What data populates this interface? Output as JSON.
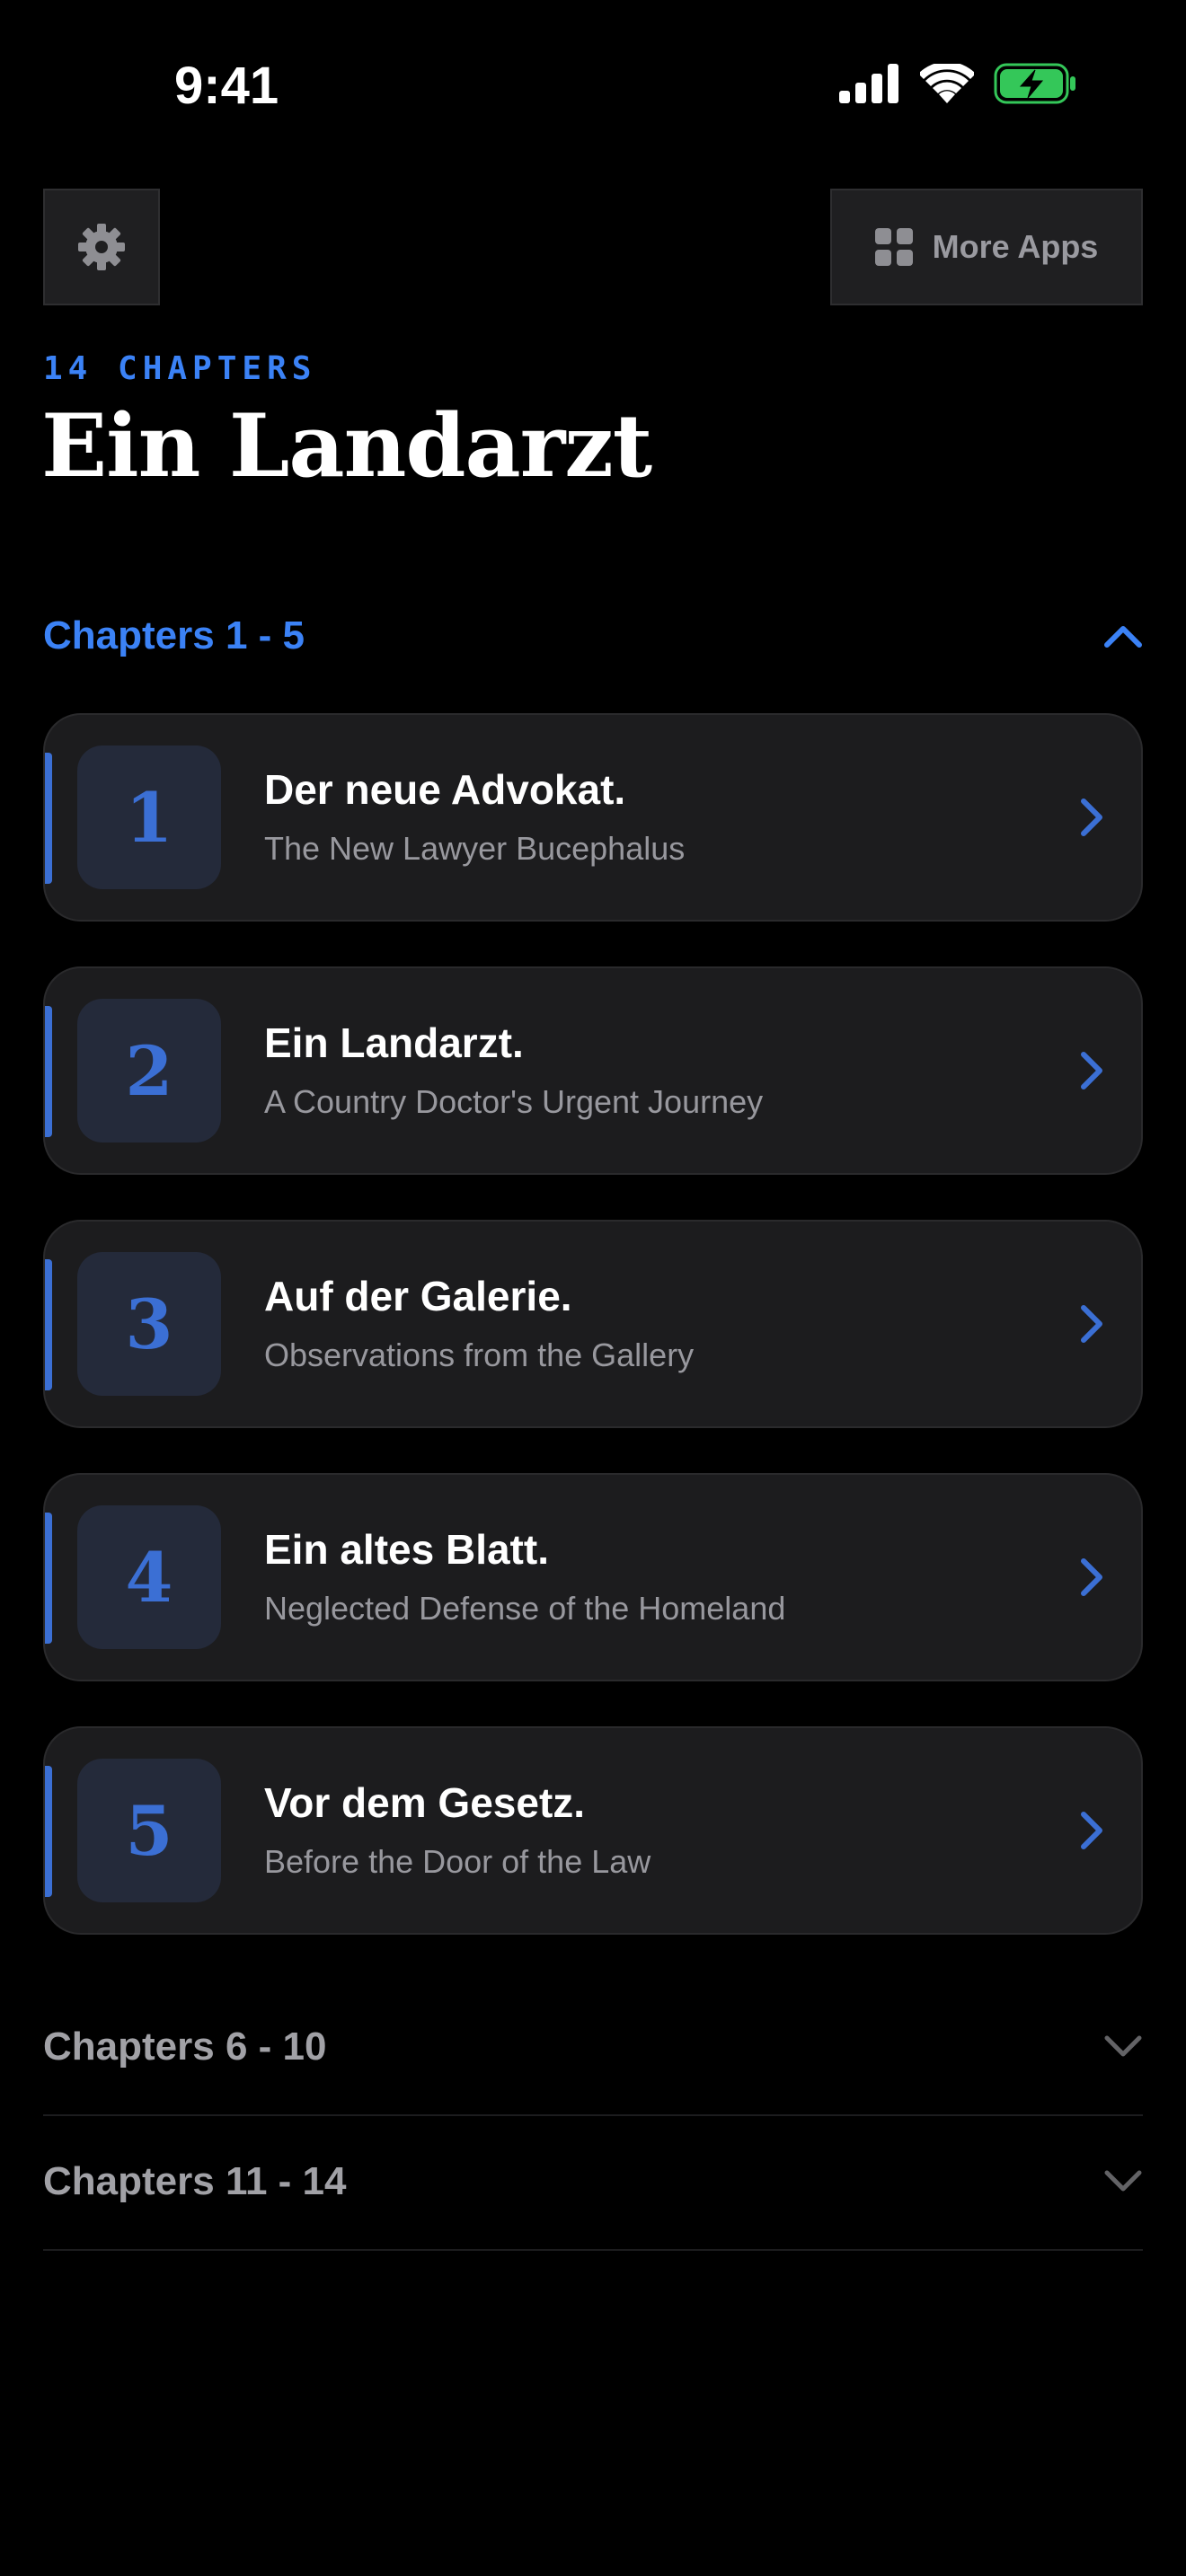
{
  "status_bar": {
    "time": "9:41"
  },
  "header": {
    "settings_icon": "gear-icon",
    "more_apps_icon": "grid-icon",
    "more_apps_label": "More Apps",
    "chapters_count": "14 CHAPTERS",
    "title": "Ein Landarzt"
  },
  "sections": [
    {
      "label": "Chapters 1 - 5",
      "expanded": true,
      "chapters": [
        {
          "number": "1",
          "title": "Der neue Advokat.",
          "subtitle": "The New Lawyer Bucephalus"
        },
        {
          "number": "2",
          "title": "Ein Landarzt.",
          "subtitle": "A Country Doctor's Urgent Journey"
        },
        {
          "number": "3",
          "title": "Auf der Galerie.",
          "subtitle": "Observations from the Gallery"
        },
        {
          "number": "4",
          "title": "Ein altes Blatt.",
          "subtitle": "Neglected Defense of the Homeland"
        },
        {
          "number": "5",
          "title": "Vor dem Gesetz.",
          "subtitle": "Before the Door of the Law"
        }
      ]
    },
    {
      "label": "Chapters 6 - 10",
      "expanded": false
    },
    {
      "label": "Chapters 11 - 14",
      "expanded": false
    }
  ],
  "colors": {
    "accent": "#3b82f6",
    "background": "#000000",
    "card": "#1c1c1e",
    "battery": "#34c759"
  }
}
